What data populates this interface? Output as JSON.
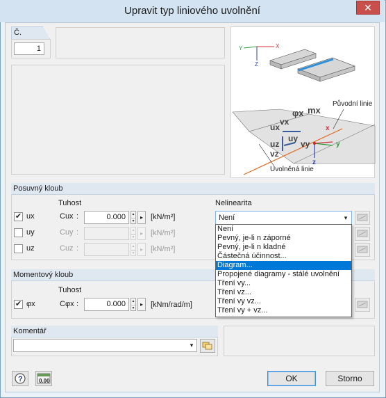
{
  "window": {
    "title": "Upravit typ liniového uvolnění",
    "close_glyph": "✕"
  },
  "number": {
    "tab_label": "Č.",
    "value": "1"
  },
  "illustration": {
    "axis_y": "Y",
    "axis_x": "X",
    "axis_z": "Z",
    "label_original": "Původní linie",
    "label_released": "Uvolněná linie",
    "phi": "φx",
    "mx": "mx",
    "vx": "vx",
    "ux": "ux",
    "uy": "uy",
    "vy": "vy",
    "uz": "uz",
    "vz": "vz",
    "local_x": "x",
    "local_y": "y",
    "local_z": "z"
  },
  "translational": {
    "header": "Posuvný kloub",
    "stiffness_header": "Tuhost",
    "nonlinearity_header": "Nelinearita",
    "rows": [
      {
        "check_label": "ux",
        "checked": true,
        "stiff_label": "Cux",
        "colon": ":",
        "value": "0.000",
        "unit": "[kN/m²]"
      },
      {
        "check_label": "uy",
        "checked": false,
        "stiff_label": "Cuy",
        "colon": ":",
        "value": "",
        "unit": "[kN/m²]"
      },
      {
        "check_label": "uz",
        "checked": false,
        "stiff_label": "Cuz",
        "colon": ":",
        "value": "",
        "unit": "[kN/m²]"
      }
    ],
    "nonlinearity_selected": "Není",
    "nonlinearity_options": [
      "Není",
      "Pevný, je-li n záporné",
      "Pevný, je-li n kladné",
      "Částečná účinnost...",
      "Diagram...",
      "Propojené diagramy - stálé uvolnění",
      "Tření vy...",
      "Tření vz...",
      "Tření vy vz...",
      "Tření vy + vz..."
    ],
    "highlighted_option": "Diagram..."
  },
  "rotational": {
    "header": "Momentový kloub",
    "stiffness_header": "Tuhost",
    "check_label": "φx",
    "checked": true,
    "stiff_label": "Cφx",
    "colon": ":",
    "value": "0.000",
    "unit": "[kNm/rad/m]"
  },
  "comment": {
    "header": "Komentář",
    "value": ""
  },
  "buttons": {
    "ok": "OK",
    "cancel": "Storno",
    "units_icon_text": "0.00"
  },
  "colors": {
    "selection": "#0078d7",
    "header_bg": "#dfe8f1",
    "axis_red": "#d0303a",
    "axis_green": "#2a9a3a",
    "axis_blue": "#2a46b0",
    "release_line": "#e06a20"
  },
  "icons": {
    "check": "✔",
    "dropdown": "▾",
    "spin_up": "▲",
    "spin_down": "▼"
  }
}
